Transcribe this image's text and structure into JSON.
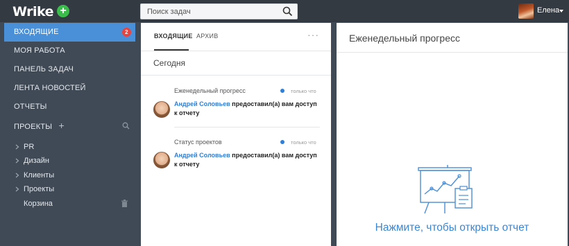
{
  "app": {
    "logo": "Wrike",
    "add_label": "+"
  },
  "search": {
    "placeholder": "Поиск задач"
  },
  "user": {
    "name": "Елена"
  },
  "sidebar": {
    "items": [
      {
        "label": "ВХОДЯЩИЕ",
        "badge": "2",
        "active": true
      },
      {
        "label": "МОЯ РАБОТА"
      },
      {
        "label": "ПАНЕЛЬ ЗАДАЧ"
      },
      {
        "label": "ЛЕНТА НОВОСТЕЙ"
      },
      {
        "label": "ОТЧЕТЫ"
      },
      {
        "label": "ПРОЕКТЫ",
        "add": "+"
      }
    ],
    "projects": [
      {
        "label": "PR"
      },
      {
        "label": "Дизайн"
      },
      {
        "label": "Клиенты"
      },
      {
        "label": "Проекты"
      }
    ],
    "trash_label": "Корзина"
  },
  "inbox": {
    "tabs": [
      {
        "label": "ВХОДЯЩИЕ"
      },
      {
        "label": "АРХИВ"
      }
    ],
    "more": "···",
    "section": "Сегодня",
    "notifications": [
      {
        "title": "Еженедельный прогресс",
        "time": "только что",
        "author": "Андрей Соловьев",
        "text": " предоставил(а) вам доступ к отчету"
      },
      {
        "title": "Статус проектов",
        "time": "только что",
        "author": "Андрей Соловьев",
        "text": " предоставил(а) вам доступ к отчету"
      }
    ]
  },
  "report": {
    "title": "Еженедельный прогресс",
    "cta": "Нажмите, чтобы открыть отчет"
  },
  "colors": {
    "accent": "#4a90d9",
    "sidebar_bg": "#3f4a56",
    "topbar_bg": "#333a42",
    "badge": "#e8443f",
    "add": "#3bbd4b",
    "link": "#2f7fd6"
  }
}
